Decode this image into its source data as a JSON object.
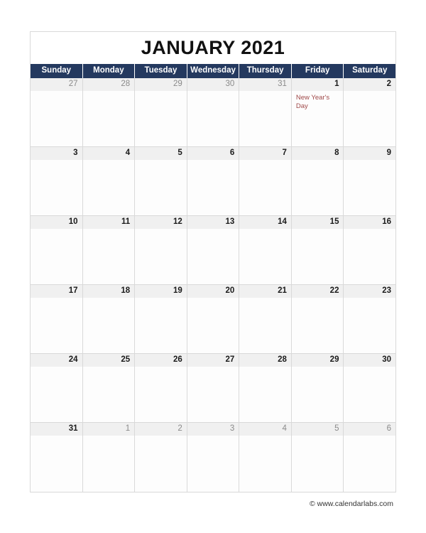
{
  "document": {
    "title": "JANUARY 2021"
  },
  "weekdays": [
    {
      "label": "Sunday"
    },
    {
      "label": "Monday"
    },
    {
      "label": "Tuesday"
    },
    {
      "label": "Wednesday"
    },
    {
      "label": "Thursday"
    },
    {
      "label": "Friday"
    },
    {
      "label": "Saturday"
    }
  ],
  "weeks": [
    {
      "days": [
        {
          "number": "27",
          "month": "other",
          "events": []
        },
        {
          "number": "28",
          "month": "other",
          "events": []
        },
        {
          "number": "29",
          "month": "other",
          "events": []
        },
        {
          "number": "30",
          "month": "other",
          "events": []
        },
        {
          "number": "31",
          "month": "other",
          "events": []
        },
        {
          "number": "1",
          "month": "current",
          "events": [
            {
              "text": "New Year's Day"
            }
          ]
        },
        {
          "number": "2",
          "month": "current",
          "events": []
        }
      ]
    },
    {
      "days": [
        {
          "number": "3",
          "month": "current",
          "events": []
        },
        {
          "number": "4",
          "month": "current",
          "events": []
        },
        {
          "number": "5",
          "month": "current",
          "events": []
        },
        {
          "number": "6",
          "month": "current",
          "events": []
        },
        {
          "number": "7",
          "month": "current",
          "events": []
        },
        {
          "number": "8",
          "month": "current",
          "events": []
        },
        {
          "number": "9",
          "month": "current",
          "events": []
        }
      ]
    },
    {
      "days": [
        {
          "number": "10",
          "month": "current",
          "events": []
        },
        {
          "number": "11",
          "month": "current",
          "events": []
        },
        {
          "number": "12",
          "month": "current",
          "events": []
        },
        {
          "number": "13",
          "month": "current",
          "events": []
        },
        {
          "number": "14",
          "month": "current",
          "events": []
        },
        {
          "number": "15",
          "month": "current",
          "events": []
        },
        {
          "number": "16",
          "month": "current",
          "events": []
        }
      ]
    },
    {
      "days": [
        {
          "number": "17",
          "month": "current",
          "events": []
        },
        {
          "number": "18",
          "month": "current",
          "events": []
        },
        {
          "number": "19",
          "month": "current",
          "events": []
        },
        {
          "number": "20",
          "month": "current",
          "events": []
        },
        {
          "number": "21",
          "month": "current",
          "events": []
        },
        {
          "number": "22",
          "month": "current",
          "events": []
        },
        {
          "number": "23",
          "month": "current",
          "events": []
        }
      ]
    },
    {
      "days": [
        {
          "number": "24",
          "month": "current",
          "events": []
        },
        {
          "number": "25",
          "month": "current",
          "events": []
        },
        {
          "number": "26",
          "month": "current",
          "events": []
        },
        {
          "number": "27",
          "month": "current",
          "events": []
        },
        {
          "number": "28",
          "month": "current",
          "events": []
        },
        {
          "number": "29",
          "month": "current",
          "events": []
        },
        {
          "number": "30",
          "month": "current",
          "events": []
        }
      ]
    },
    {
      "days": [
        {
          "number": "31",
          "month": "current",
          "events": []
        },
        {
          "number": "1",
          "month": "other",
          "events": []
        },
        {
          "number": "2",
          "month": "other",
          "events": []
        },
        {
          "number": "3",
          "month": "other",
          "events": []
        },
        {
          "number": "4",
          "month": "other",
          "events": []
        },
        {
          "number": "5",
          "month": "other",
          "events": []
        },
        {
          "number": "6",
          "month": "other",
          "events": []
        }
      ]
    }
  ],
  "footer": {
    "credit": "© www.calendarlabs.com"
  },
  "colors": {
    "header_bg": "#24395f",
    "header_text": "#ffffff",
    "date_strip_bg": "#f0f0f0",
    "current_month_text": "#1a1a1a",
    "other_month_text": "#8a8a8a",
    "event_text": "#a04a4a",
    "grid_line": "#d9d9d9",
    "title_text": "#111111"
  }
}
